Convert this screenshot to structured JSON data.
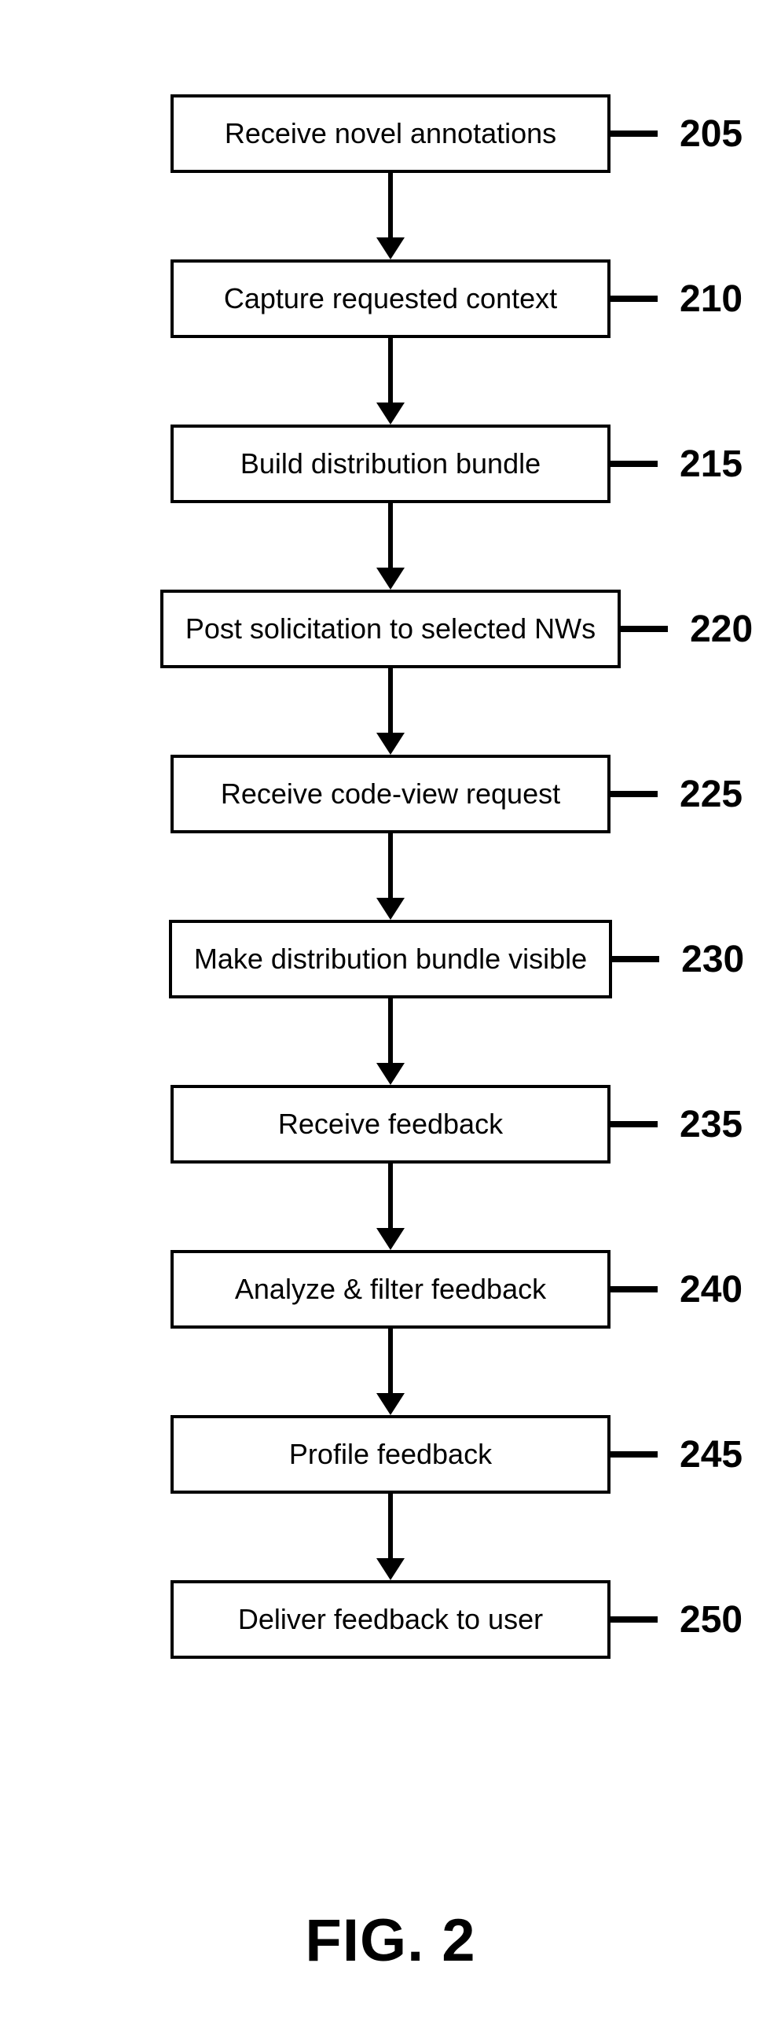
{
  "figure_label": "FIG. 2",
  "steps": [
    {
      "label": "Receive novel annotations",
      "ref": "205"
    },
    {
      "label": "Capture requested context",
      "ref": "210"
    },
    {
      "label": "Build distribution bundle",
      "ref": "215"
    },
    {
      "label": "Post solicitation to selected NWs",
      "ref": "220"
    },
    {
      "label": "Receive code-view request",
      "ref": "225"
    },
    {
      "label": "Make distribution bundle visible",
      "ref": "230"
    },
    {
      "label": "Receive feedback",
      "ref": "235"
    },
    {
      "label": "Analyze & filter feedback",
      "ref": "240"
    },
    {
      "label": "Profile feedback",
      "ref": "245"
    },
    {
      "label": "Deliver feedback to user",
      "ref": "250"
    }
  ]
}
